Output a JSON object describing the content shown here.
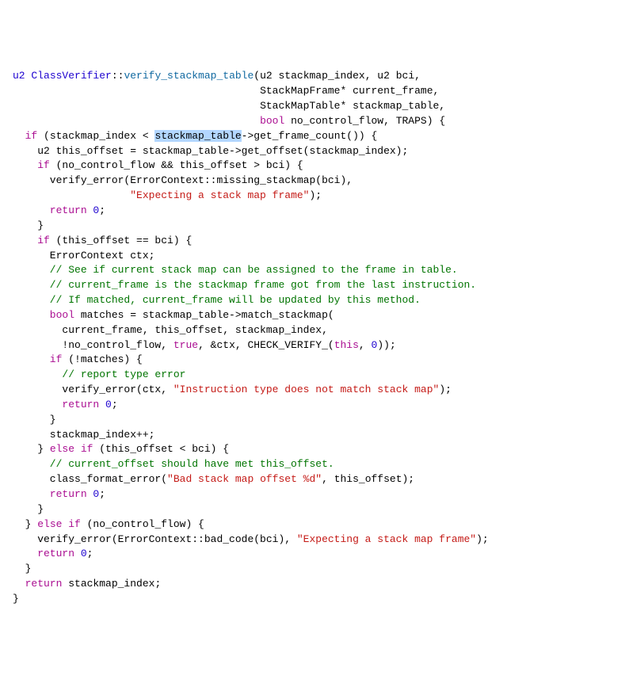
{
  "sig": {
    "ret_type": "u2",
    "cls": "ClassVerifier",
    "fn": "verify_stackmap_table",
    "p1": "(u2 stackmap_index, u2 bci,",
    "p2": "StackMapFrame* current_frame,",
    "p3": "StackMapTable* stackmap_table,",
    "p4_pre": "bool",
    "p4_post": " no_control_flow, TRAPS) {"
  },
  "l_if1_pre": "  if",
  "l_if1_mid": " (stackmap_index < ",
  "l_if1_hl": "stackmap_table",
  "l_if1_post": "->get_frame_count()) {",
  "l_u2": "    u2 this_offset = stackmap_table->get_offset(stackmap_index);",
  "l_if2_pre": "    if",
  "l_if2_post": " (no_control_flow && this_offset > bci) {",
  "l_ve1_pre": "      verify_error(ErrorContext::missing_stackmap(bci),",
  "l_ve1_str": "\"Expecting a stack map frame\"",
  "l_ve1_post": ");",
  "l_ret0_pre": "      return",
  "l_ret0_post": " 0",
  "l_ret0_semi": ";",
  "l_close_brace_6": "    }",
  "l_if3_pre": "    if",
  "l_if3_post": " (this_offset == bci) {",
  "l_ctx": "      ErrorContext ctx;",
  "l_c1": "      // See if current stack map can be assigned to the frame in table.",
  "l_c2": "      // current_frame is the stackmap frame got from the last instruction.",
  "l_c3": "      // If matched, current_frame will be updated by this method.",
  "l_bool_pre": "      bool",
  "l_bool_post": " matches = stackmap_table->match_stackmap(",
  "l_arg1": "        current_frame, this_offset, stackmap_index,",
  "l_arg2_pre": "        !no_control_flow, ",
  "l_arg2_true": "true",
  "l_arg2_mid": ", &ctx, CHECK_VERIFY_(",
  "l_arg2_this": "this",
  "l_arg2_post": ", ",
  "l_arg2_num": "0",
  "l_arg2_end": "));",
  "l_if4_pre": "      if",
  "l_if4_post": " (!matches) {",
  "l_c4": "        // report type error",
  "l_ve2_pre": "        verify_error(ctx, ",
  "l_ve2_str": "\"Instruction type does not match stack map\"",
  "l_ve2_post": ");",
  "l_ret1_pre": "        return",
  "l_ret1_post": " 0",
  "l_close_brace_8": "      }",
  "l_inc": "      stackmap_index++;",
  "l_elif_pre": "    } ",
  "l_elif_kw": "else if",
  "l_elif_post": " (this_offset < bci) {",
  "l_c5": "      // current_offset should have met this_offset.",
  "l_cfe_pre": "      class_format_error(",
  "l_cfe_str": "\"Bad stack map offset %d\"",
  "l_cfe_post": ", this_offset);",
  "l_ret2_pre": "      return",
  "l_ret2_post": " 0",
  "l_elif2_pre": "  } ",
  "l_elif2_kw": "else if",
  "l_elif2_post": " (no_control_flow) {",
  "l_ve3_pre": "    verify_error(ErrorContext::bad_code(bci), ",
  "l_ve3_str": "\"Expecting a stack map frame\"",
  "l_ve3_post": ");",
  "l_ret3_pre": "    return",
  "l_ret3_post": " 0",
  "l_close_brace_4": "  }",
  "l_retidx_pre": "  return",
  "l_retidx_post": " stackmap_index;",
  "l_close_brace_0": "}"
}
